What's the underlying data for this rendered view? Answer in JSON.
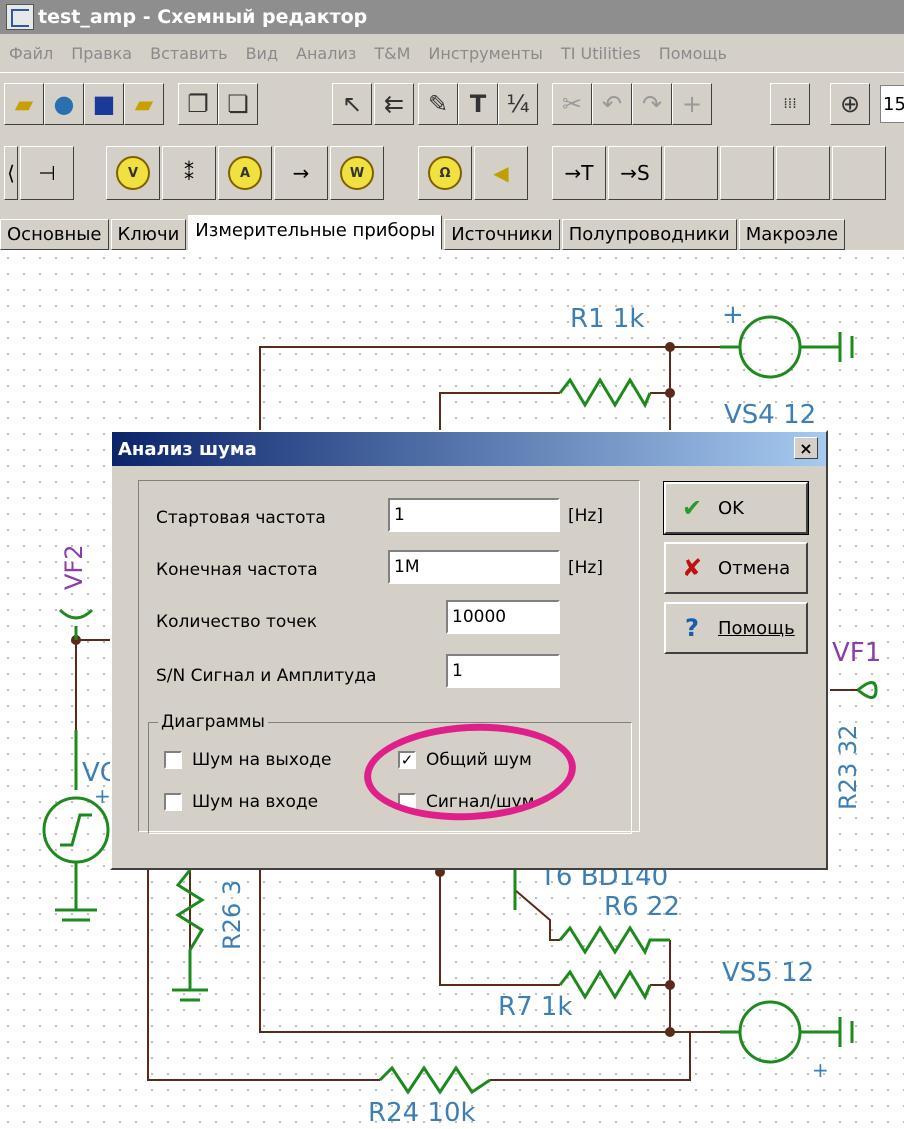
{
  "window": {
    "title": "test_amp - Схемный редактор"
  },
  "menu": [
    "Файл",
    "Правка",
    "Вставить",
    "Вид",
    "Анализ",
    "T&M",
    "Инструменты",
    "TI Utilities",
    "Помощь"
  ],
  "toolbar": {
    "zoom_value": "15"
  },
  "component_toolbar": {
    "items": [
      "→T",
      "→S"
    ]
  },
  "tabs": [
    "Основные",
    "Ключи",
    "Измерительные приборы",
    "Источники",
    "Полупроводники",
    "Макроэле"
  ],
  "schematic": {
    "labels": {
      "r1": "R1 1k",
      "vs4": "VS4 12",
      "vf2": "VF2",
      "vf1": "VF1",
      "r23": "R23 32",
      "vg": "VG",
      "r26": "R26 3",
      "t6": "T6 BD140",
      "r6": "R6 22",
      "r7": "R7 1k",
      "vs5": "VS5 12",
      "r24": "R24 10k",
      "plus1": "+",
      "plus2": "+",
      "plus3": "+"
    }
  },
  "dialog": {
    "title": "Анализ шума",
    "close": "×",
    "fields": {
      "start_freq_label": "Стартовая частота",
      "start_freq_value": "1",
      "start_freq_unit": "[Hz]",
      "end_freq_label": "Конечная частота",
      "end_freq_value": "1M",
      "end_freq_unit": "[Hz]",
      "points_label": "Количество точек",
      "points_value": "10000",
      "sn_label": "S/N Сигнал и Амплитуда",
      "sn_value": "1"
    },
    "diagrams": {
      "legend": "Диаграммы",
      "output_noise": "Шум на выходе",
      "output_noise_checked": false,
      "total_noise": "Общий шум",
      "total_noise_checked": true,
      "input_noise": "Шум на входе",
      "input_noise_checked": false,
      "signal_noise": "Сигнал/шум",
      "signal_noise_checked": false
    },
    "buttons": {
      "ok": "OK",
      "cancel": "Отмена",
      "help": "Помощь"
    }
  },
  "colors": {
    "wire": "#5a2a1a",
    "component": "#1e8a1e",
    "label": "#3d7fb3",
    "highlight": "#e0208a"
  }
}
